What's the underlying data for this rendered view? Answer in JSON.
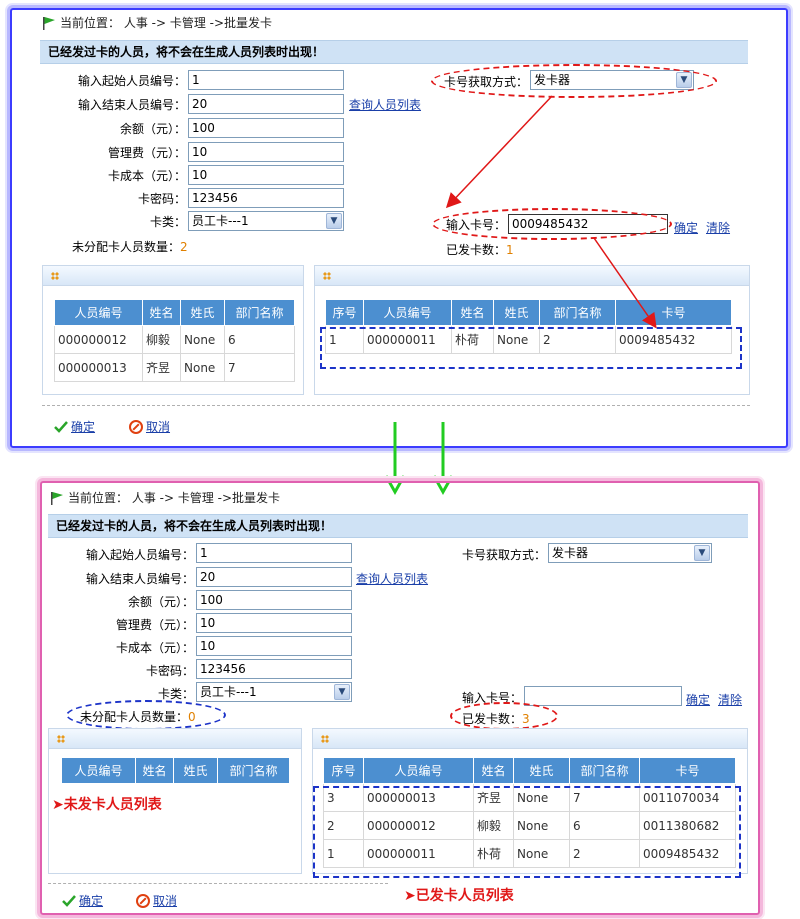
{
  "top": {
    "breadcrumb": "当前位置： 人事 -> 卡管理 ->批量发卡",
    "notice": "已经发过卡的人员，将不会在生成人员列表时出现！",
    "form": {
      "start_label": "输入起始人员编号：",
      "start_value": "1",
      "end_label": "输入结束人员编号：",
      "end_value": "20",
      "query_link": "查询人员列表",
      "balance_label": "余额（元）：",
      "balance_value": "100",
      "fee_label": "管理费（元）：",
      "fee_value": "10",
      "cost_label": "卡成本（元）：",
      "cost_value": "10",
      "pwd_label": "卡密码：",
      "pwd_value": "123456",
      "type_label": "卡类：",
      "type_value": "员工卡---1",
      "unassigned_label": "未分配卡人员数量：",
      "unassigned_value": "2",
      "method_label": "卡号获取方式：",
      "method_value": "发卡器",
      "cardno_label": "输入卡号：",
      "cardno_value": "0009485432",
      "confirm_link": "确定",
      "clear_link": "清除",
      "issued_label": "已发卡数：",
      "issued_value": "1"
    },
    "left_table": {
      "headers": [
        "人员编号",
        "姓名",
        "姓氏",
        "部门名称"
      ],
      "rows": [
        [
          "000000012",
          "柳毅",
          "None",
          "6"
        ],
        [
          "000000013",
          "齐昱",
          "None",
          "7"
        ]
      ]
    },
    "right_table": {
      "headers": [
        "序号",
        "人员编号",
        "姓名",
        "姓氏",
        "部门名称",
        "卡号"
      ],
      "rows": [
        [
          "1",
          "000000011",
          "朴荷",
          "None",
          "2",
          "0009485432"
        ]
      ]
    },
    "ok_label": "确定",
    "cancel_label": "取消"
  },
  "bottom": {
    "breadcrumb": "当前位置： 人事 -> 卡管理 ->批量发卡",
    "notice": "已经发过卡的人员，将不会在生成人员列表时出现！",
    "form": {
      "start_label": "输入起始人员编号：",
      "start_value": "1",
      "end_label": "输入结束人员编号：",
      "end_value": "20",
      "query_link": "查询人员列表",
      "balance_label": "余额（元）：",
      "balance_value": "100",
      "fee_label": "管理费（元）：",
      "fee_value": "10",
      "cost_label": "卡成本（元）：",
      "cost_value": "10",
      "pwd_label": "卡密码：",
      "pwd_value": "123456",
      "type_label": "卡类：",
      "type_value": "员工卡---1",
      "unassigned_label": "未分配卡人员数量：",
      "unassigned_value": "0",
      "method_label": "卡号获取方式：",
      "method_value": "发卡器",
      "cardno_label": "输入卡号：",
      "cardno_value": "",
      "confirm_link": "确定",
      "clear_link": "清除",
      "issued_label": "已发卡数：",
      "issued_value": "3"
    },
    "left_table": {
      "headers": [
        "人员编号",
        "姓名",
        "姓氏",
        "部门名称"
      ],
      "rows": []
    },
    "right_table": {
      "headers": [
        "序号",
        "人员编号",
        "姓名",
        "姓氏",
        "部门名称",
        "卡号"
      ],
      "rows": [
        [
          "3",
          "000000013",
          "齐昱",
          "None",
          "7",
          "0011070034"
        ],
        [
          "2",
          "000000012",
          "柳毅",
          "None",
          "6",
          "0011380682"
        ],
        [
          "1",
          "000000011",
          "朴荷",
          "None",
          "2",
          "0009485432"
        ]
      ]
    },
    "unissued_note": "未发卡人员列表",
    "issued_note": "已发卡人员列表",
    "ok_label": "确定",
    "cancel_label": "取消"
  },
  "colors": {
    "accent_blue": "#3c3cff",
    "accent_pink": "#e060b0",
    "annotation_red": "#e01818",
    "annotation_blue": "#1c33c8",
    "arrow_green": "#22cc22",
    "table_header": "#4c8fd0"
  }
}
